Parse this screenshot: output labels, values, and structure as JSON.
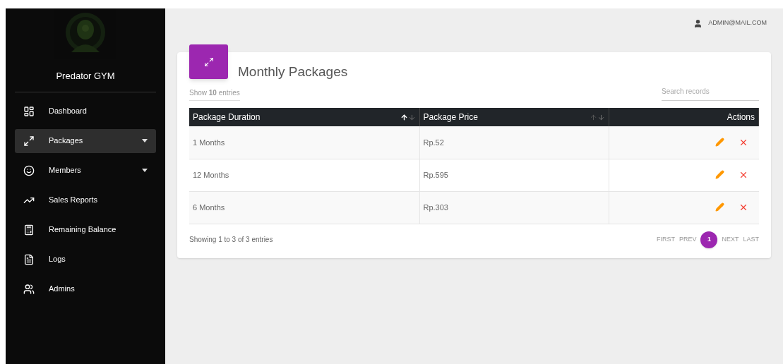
{
  "sidebar": {
    "brand": "Predator GYM",
    "items": [
      {
        "label": "Dashboard",
        "selected": false,
        "submenu": false
      },
      {
        "label": "Packages",
        "selected": true,
        "submenu": true
      },
      {
        "label": "Members",
        "selected": false,
        "submenu": true
      },
      {
        "label": "Sales Reports",
        "selected": false,
        "submenu": false
      },
      {
        "label": "Remaining Balance",
        "selected": false,
        "submenu": false
      },
      {
        "label": "Logs",
        "selected": false,
        "submenu": false
      },
      {
        "label": "Admins",
        "selected": false,
        "submenu": false
      }
    ]
  },
  "topbar": {
    "user": "ADMIN@MAIL.COM"
  },
  "card": {
    "title": "Monthly Packages",
    "show_entries": "Show **10** entries",
    "search": {
      "placeholder": "Search records"
    },
    "table": {
      "columns": [
        {
          "label": "Package Duration",
          "kind": "sortable",
          "selected": true
        },
        {
          "label": "Package Price",
          "kind": "sortable",
          "selected": false
        },
        {
          "label": "Actions",
          "kind": "plain"
        }
      ],
      "rows": [
        {
          "duration": "1 Months",
          "price": "Rp.52"
        },
        {
          "duration": "12 Months",
          "price": "Rp.595"
        },
        {
          "duration": "6 Months",
          "price": "Rp.303"
        }
      ]
    },
    "info": "Showing 1 to 3 of 3 entries",
    "pagination": [
      {
        "label": "FIRST",
        "selected": false
      },
      {
        "label": "PREV",
        "selected": false
      },
      {
        "label": "1",
        "selected": true
      },
      {
        "label": "NEXT",
        "selected": false
      },
      {
        "label": "LAST",
        "selected": false
      }
    ]
  }
}
